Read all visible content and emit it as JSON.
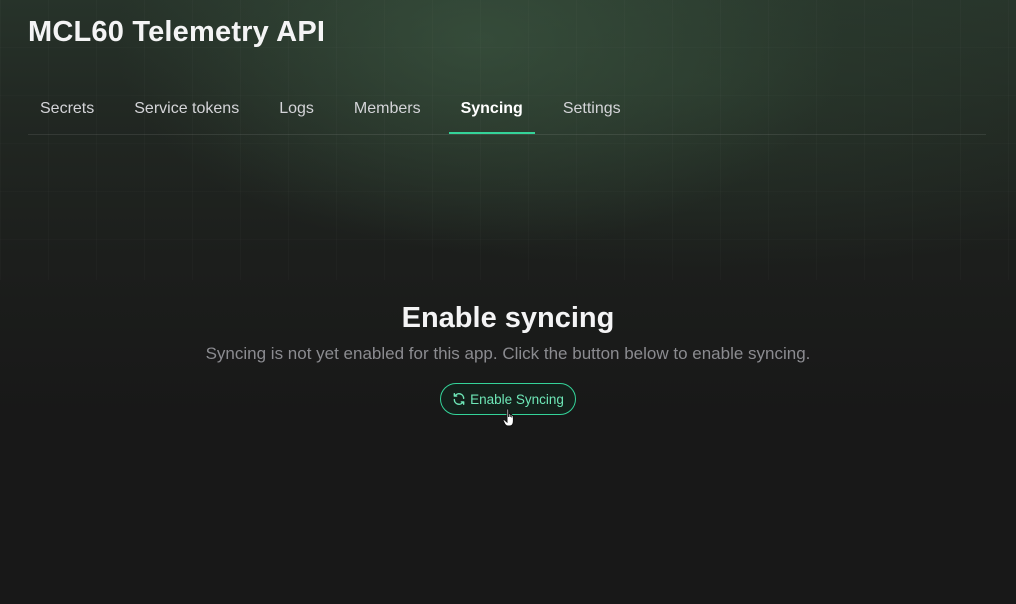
{
  "header": {
    "app_title": "MCL60 Telemetry API"
  },
  "tabs": [
    {
      "label": "Secrets",
      "active": false
    },
    {
      "label": "Service tokens",
      "active": false
    },
    {
      "label": "Logs",
      "active": false
    },
    {
      "label": "Members",
      "active": false
    },
    {
      "label": "Syncing",
      "active": true
    },
    {
      "label": "Settings",
      "active": false
    }
  ],
  "empty_state": {
    "title": "Enable syncing",
    "description": "Syncing is not yet enabled for this app. Click the button below to enable syncing.",
    "button_label": "Enable Syncing",
    "button_icon": "refresh-icon"
  },
  "colors": {
    "accent": "#34d399",
    "accent_text": "#6ee7b7",
    "background": "#181818"
  }
}
